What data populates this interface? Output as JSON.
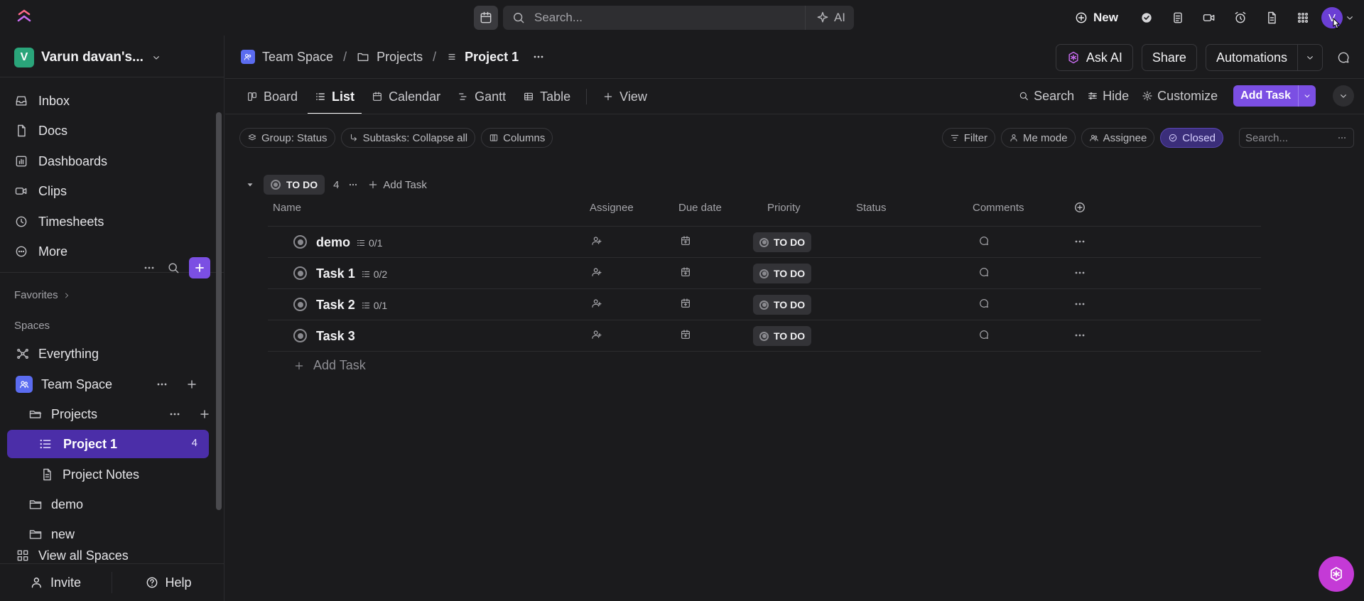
{
  "topbar": {
    "search_placeholder": "Search...",
    "ai_label": "AI",
    "new_label": "New",
    "avatar_initial": "V"
  },
  "sidebar": {
    "workspace_initial": "V",
    "workspace_name": "Varun davan's...",
    "nav": [
      {
        "label": "Inbox",
        "icon": "inbox-icon"
      },
      {
        "label": "Docs",
        "icon": "doc-icon"
      },
      {
        "label": "Dashboards",
        "icon": "dashboard-icon"
      },
      {
        "label": "Clips",
        "icon": "video-icon"
      },
      {
        "label": "Timesheets",
        "icon": "timer-icon"
      },
      {
        "label": "More",
        "icon": "more-icon"
      }
    ],
    "favorites_label": "Favorites",
    "spaces_label": "Spaces",
    "tree": {
      "everything": "Everything",
      "team_space": "Team Space",
      "projects": "Projects",
      "project1": "Project 1",
      "project1_count": "4",
      "project_notes": "Project Notes",
      "demo": "demo",
      "new": "new",
      "view_all": "View all Spaces"
    },
    "invite_label": "Invite",
    "help_label": "Help"
  },
  "header": {
    "breadcrumbs": [
      "Team Space",
      "Projects",
      "Project 1"
    ],
    "separator": "/",
    "ask_ai": "Ask AI",
    "share": "Share",
    "automations": "Automations"
  },
  "views": {
    "tabs": [
      "Board",
      "List",
      "Calendar",
      "Gantt",
      "Table"
    ],
    "active": "List",
    "add_view": "View",
    "search": "Search",
    "hide": "Hide",
    "customize": "Customize",
    "add_task": "Add Task"
  },
  "filters": {
    "group": "Group: Status",
    "subtasks": "Subtasks: Collapse all",
    "columns": "Columns",
    "filter": "Filter",
    "me_mode": "Me mode",
    "assignee": "Assignee",
    "closed": "Closed",
    "search_placeholder": "Search..."
  },
  "group": {
    "status": "TO DO",
    "count": "4",
    "add_task": "Add Task"
  },
  "columns": {
    "name": "Name",
    "assignee": "Assignee",
    "due_date": "Due date",
    "priority": "Priority",
    "status": "Status",
    "comments": "Comments"
  },
  "tasks": [
    {
      "name": "demo",
      "subtasks": "0/1",
      "status": "TO DO"
    },
    {
      "name": "Task 1",
      "subtasks": "0/2",
      "status": "TO DO"
    },
    {
      "name": "Task 2",
      "subtasks": "0/1",
      "status": "TO DO"
    },
    {
      "name": "Task 3",
      "subtasks": "",
      "status": "TO DO"
    }
  ],
  "add_task_row": "Add Task",
  "colors": {
    "accent": "#7b4fe3",
    "active_row": "#4b2ea8",
    "fab": "#c43ad6",
    "workspace_badge": "#2aa57a"
  }
}
